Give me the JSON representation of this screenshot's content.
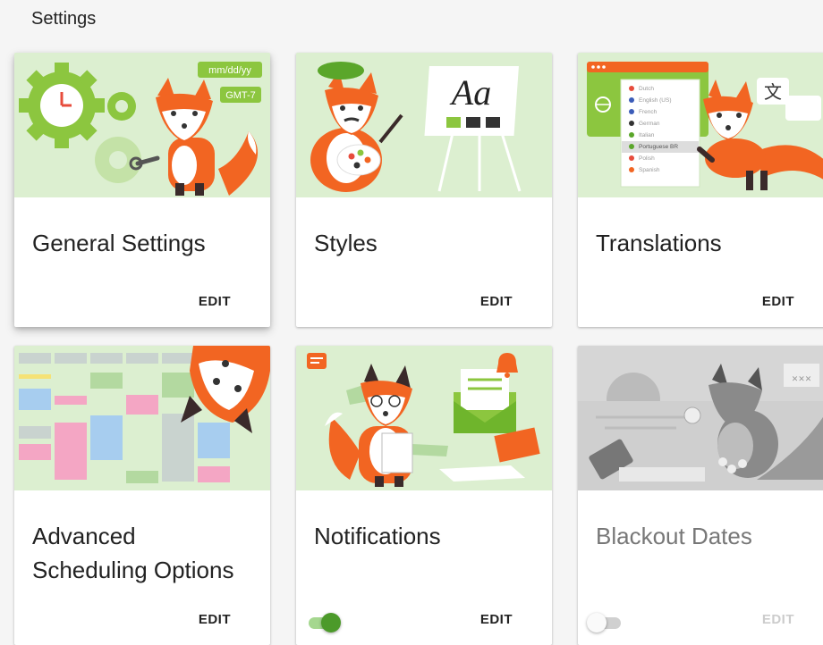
{
  "page": {
    "title": "Settings"
  },
  "colors": {
    "accent": "#4c9a2a",
    "fox": "#f26522",
    "illustration_bg": "#dcefd0"
  },
  "cards": [
    {
      "title": "General Settings",
      "edit_label": "EDIT",
      "illustration": {
        "date_format": "mm/dd/yy",
        "timezone": "GMT-7"
      }
    },
    {
      "title": "Styles",
      "edit_label": "EDIT",
      "illustration": {
        "sample": "Aa"
      }
    },
    {
      "title": "Translations",
      "edit_label": "EDIT",
      "illustration": {
        "glyph": "文",
        "languages": [
          "Dutch",
          "English (US)",
          "French",
          "German",
          "Italian",
          "Portuguese BR",
          "Polish",
          "Spanish"
        ]
      }
    },
    {
      "title": "Advanced Scheduling Options",
      "title_line1": "Advanced",
      "title_line2": "Scheduling Options",
      "edit_label": "EDIT"
    },
    {
      "title": "Notifications",
      "edit_label": "EDIT",
      "toggle": "on"
    },
    {
      "title": "Blackout Dates",
      "edit_label": "EDIT",
      "toggle": "off",
      "disabled": true
    }
  ]
}
